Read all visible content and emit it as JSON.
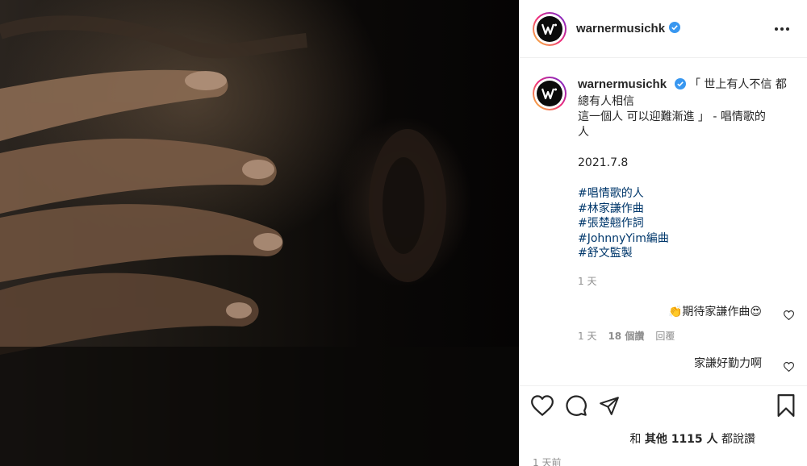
{
  "post": {
    "username": "warnermusichk",
    "avatar_letter": "W",
    "brand_color": "#0095f6",
    "caption_line1": "「 世上有人不信 都",
    "caption_lines": "總有人相信\n這一個人 可以迎難漸進 」 - 唱情歌的\n人",
    "date": "2021.7.8",
    "hashtags": [
      "#唱情歌的人",
      "#林家謙作曲",
      "#張楚翹作詞",
      "#JohnnyYim編曲",
      "#舒文監製"
    ],
    "caption_time": "1 天"
  },
  "comments": [
    {
      "text": "👏期待家謙作曲😍",
      "time": "1 天",
      "likes": "18 個讚",
      "reply_label": "回覆"
    },
    {
      "text": "家謙好勤力啊"
    }
  ],
  "footer": {
    "likes_prefix": "和",
    "likes_count": "其他 1115 人",
    "likes_suffix": "都說讚",
    "posted": "1 天前"
  },
  "icons": [
    "more-icon",
    "verified-icon",
    "heart-icon",
    "comment-icon",
    "share-icon",
    "bookmark-icon"
  ]
}
